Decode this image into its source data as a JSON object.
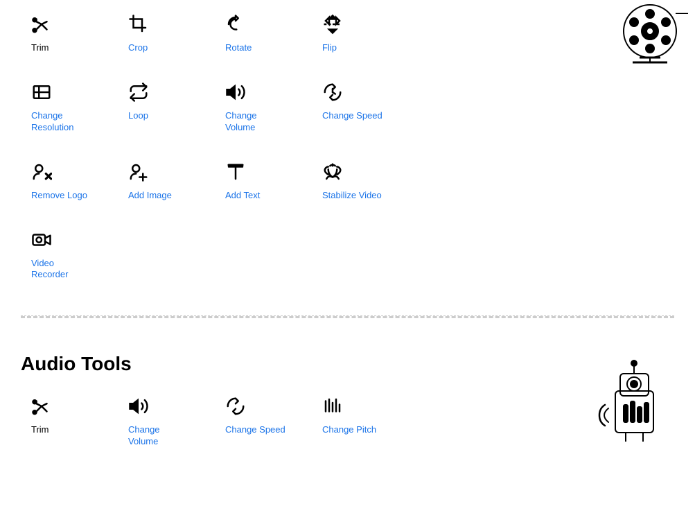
{
  "video_tools": {
    "row1": [
      {
        "id": "trim",
        "label": "Trim",
        "icon": "scissors",
        "color": "black"
      },
      {
        "id": "crop",
        "label": "Crop",
        "icon": "crop",
        "color": "blue"
      },
      {
        "id": "rotate",
        "label": "Rotate",
        "icon": "rotate",
        "color": "blue"
      },
      {
        "id": "flip",
        "label": "Flip",
        "icon": "flip",
        "color": "blue"
      }
    ],
    "row2": [
      {
        "id": "change-resolution",
        "label": "Change\nResolution",
        "icon": "resolution",
        "color": "blue"
      },
      {
        "id": "loop",
        "label": "Loop",
        "icon": "loop",
        "color": "blue"
      },
      {
        "id": "change-volume",
        "label": "Change\nVolume",
        "icon": "volume",
        "color": "blue"
      },
      {
        "id": "change-speed",
        "label": "Change Speed",
        "icon": "speed",
        "color": "blue"
      }
    ],
    "row3": [
      {
        "id": "remove-logo",
        "label": "Remove Logo",
        "icon": "remove-logo",
        "color": "blue"
      },
      {
        "id": "add-image",
        "label": "Add Image",
        "icon": "add-image",
        "color": "blue"
      },
      {
        "id": "add-text",
        "label": "Add Text",
        "icon": "add-text",
        "color": "selected"
      },
      {
        "id": "stabilize-video",
        "label": "Stabilize Video",
        "icon": "stabilize",
        "color": "blue"
      }
    ],
    "row4": [
      {
        "id": "video-recorder",
        "label": "Video\nRecorder",
        "icon": "recorder",
        "color": "blue"
      }
    ]
  },
  "audio_tools": {
    "title": "Audio Tools",
    "row1": [
      {
        "id": "trim-audio",
        "label": "Trim",
        "icon": "scissors",
        "color": "black"
      },
      {
        "id": "change-volume-audio",
        "label": "Change\nVolume",
        "icon": "volume",
        "color": "blue"
      },
      {
        "id": "change-speed-audio",
        "label": "Change Speed",
        "icon": "speed",
        "color": "blue"
      },
      {
        "id": "change-pitch",
        "label": "Change Pitch",
        "icon": "pitch",
        "color": "blue"
      }
    ]
  }
}
